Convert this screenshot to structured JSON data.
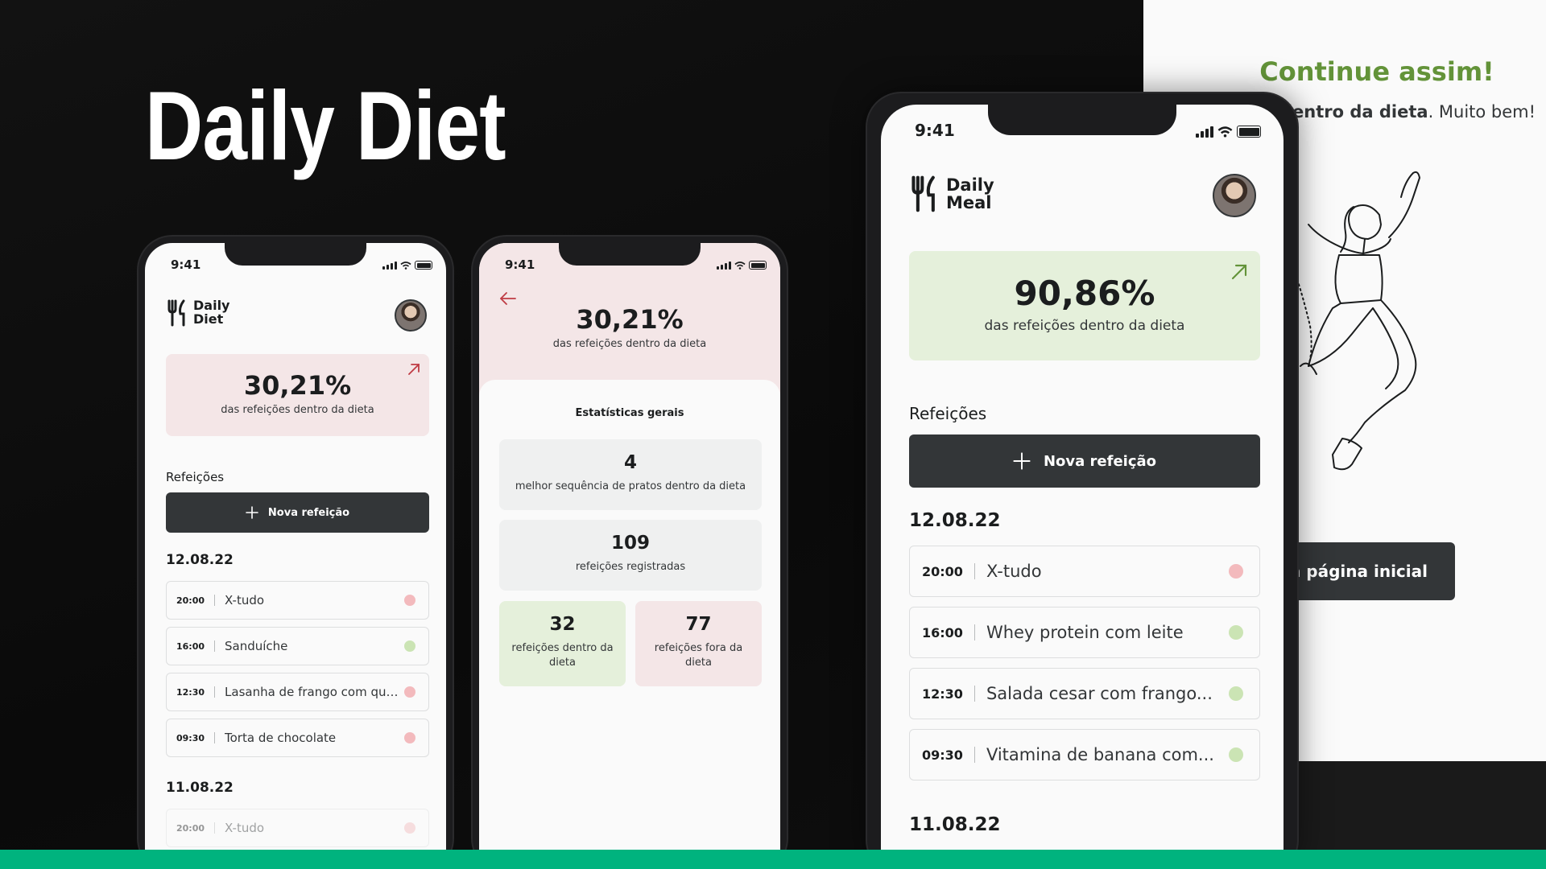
{
  "hero": {
    "title": "Daily Diet"
  },
  "status": {
    "time": "9:41"
  },
  "feedback": {
    "title": "Continue assim!",
    "subtitle_bold": "dentro da dieta",
    "subtitle_rest": ". Muito bem!",
    "button_label": "ra a página inicial"
  },
  "phone1": {
    "logo_line1": "Daily",
    "logo_line2": "Diet",
    "percent": "30,21%",
    "percent_label": "das refeições dentro da dieta",
    "section_label": "Refeições",
    "new_meal_label": "Nova refeição",
    "date1": "12.08.22",
    "meals1": [
      {
        "time": "20:00",
        "name": "X-tudo",
        "status": "red"
      },
      {
        "time": "16:00",
        "name": "Sanduíche",
        "status": "green"
      },
      {
        "time": "12:30",
        "name": "Lasanha de frango com queijo",
        "status": "red"
      },
      {
        "time": "09:30",
        "name": "Torta de chocolate",
        "status": "red"
      }
    ],
    "date2": "11.08.22",
    "meals2": [
      {
        "time": "20:00",
        "name": "X-tudo",
        "status": "red"
      }
    ]
  },
  "phone2": {
    "percent": "30,21%",
    "percent_label": "das refeições dentro da dieta",
    "stats_title": "Estatísticas gerais",
    "best_sequence_value": "4",
    "best_sequence_label": "melhor sequência de pratos dentro da dieta",
    "registered_value": "109",
    "registered_label": "refeições registradas",
    "inside_value": "32",
    "inside_label": "refeições dentro da dieta",
    "outside_value": "77",
    "outside_label": "refeições fora da dieta"
  },
  "phone3": {
    "logo_line1": "Daily",
    "logo_line2": "Meal",
    "percent": "90,86%",
    "percent_label": "das refeições dentro da dieta",
    "section_label": "Refeições",
    "new_meal_label": "Nova refeição",
    "date1": "12.08.22",
    "meals1": [
      {
        "time": "20:00",
        "name": "X-tudo",
        "status": "red"
      },
      {
        "time": "16:00",
        "name": "Whey protein com leite",
        "status": "green"
      },
      {
        "time": "12:30",
        "name": "Salada cesar com frango...",
        "status": "green"
      },
      {
        "time": "09:30",
        "name": "Vitamina de banana com...",
        "status": "green"
      }
    ],
    "date2": "11.08.22"
  },
  "colors": {
    "brand_green": "#00b37e",
    "dark": "#333638",
    "red_light": "#f4e6e7",
    "green_light": "#e5f0db",
    "red_mid": "#f3babd",
    "green_mid": "#cbe4b4",
    "red_dark": "#bf3b44",
    "green_dark": "#639339"
  }
}
